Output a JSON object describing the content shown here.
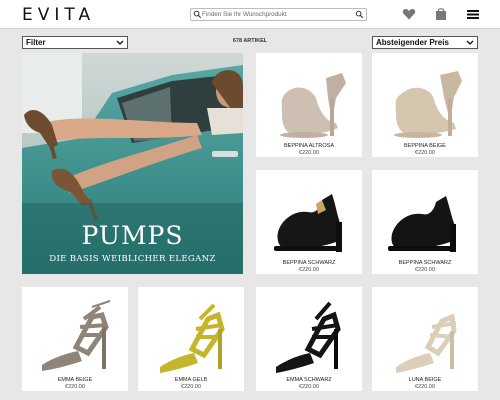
{
  "header": {
    "logo": "EVITA",
    "search_placeholder": "Finden Sie Ihr Wunschprodukt",
    "icons": [
      "search-icon",
      "heart-icon",
      "shopping-bag-icon",
      "hamburger-menu-icon"
    ]
  },
  "toolbar": {
    "filter_label": "Filter",
    "article_count": "678 ARTIKEL",
    "sort_label": "Absteigender Preis"
  },
  "banner": {
    "title": "PUMPS",
    "subtitle": "DIE BASIS WEIBLICHER ELEGANZ"
  },
  "products": [
    {
      "name": "BEPPINA ALTROSA",
      "price": "€220.00",
      "color": "#c9b9aa"
    },
    {
      "name": "BEPPINA BEIGE",
      "price": "€220.00",
      "color": "#d3c4ad"
    },
    {
      "name": "BEPPINA SCHWARZ",
      "price": "€220.00",
      "color": "#161616"
    },
    {
      "name": "BEPPINA SCHWARZ",
      "price": "€220.00",
      "color": "#161616"
    },
    {
      "name": "EMMA BEIGE",
      "price": "€220.00",
      "color": "#8e8577"
    },
    {
      "name": "EMMA GELB",
      "price": "€220.00",
      "color": "#c4b52b"
    },
    {
      "name": "EMMA SCHWARZ",
      "price": "€220.00",
      "color": "#141414"
    },
    {
      "name": "LUNA BEIGE",
      "price": "€220.00",
      "color": "#dccfb9"
    }
  ]
}
